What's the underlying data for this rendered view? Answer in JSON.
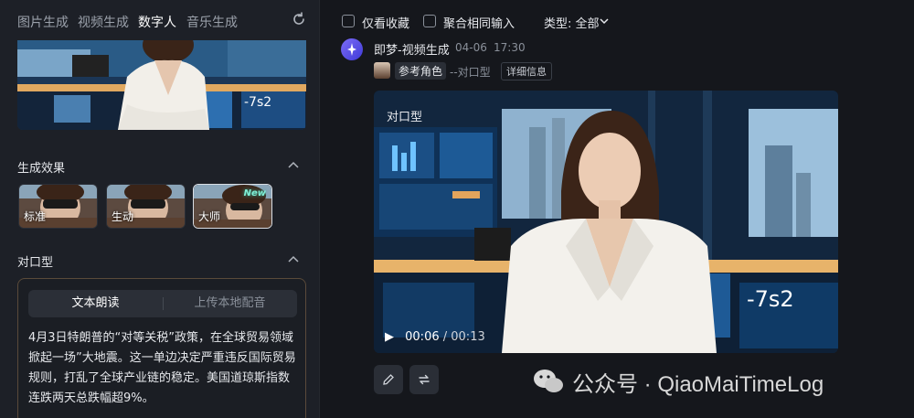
{
  "tabs": [
    "图片生成",
    "视频生成",
    "数字人",
    "音乐生成"
  ],
  "active_tab": 2,
  "sections": {
    "effect_title": "生成效果",
    "lipsync_title": "对口型"
  },
  "effects": [
    {
      "label": "标准",
      "selected": false
    },
    {
      "label": "生动",
      "selected": false
    },
    {
      "label": "大师",
      "selected": true,
      "badge": "New"
    }
  ],
  "lipsync": {
    "tabs": [
      "文本朗读",
      "上传本地配音"
    ],
    "active": 0,
    "text": "4月3日特朗普的“对等关税”政策，在全球贸易领域掀起一场”大地震。这一单边决定严重违反国际贸易规则，打乱了全球产业链的稳定。美国道琼斯指数连跌两天总跌幅超9%。"
  },
  "filters": {
    "favorites_only": "仅看收藏",
    "merge_same_input": "聚合相同输入",
    "type_label": "类型: 全部"
  },
  "generation": {
    "title": "即梦-视频生成",
    "date": "04-06",
    "time": "17:30",
    "ref_label": "参考角色",
    "ref_type": "--对口型",
    "detail_button": "详细信息",
    "video_tag": "对口型",
    "current_time": "00:06",
    "duration": "00:13"
  },
  "watermark": "公众号 · QiaoMaiTimeLog",
  "colors": {
    "background": "#15171c",
    "panel": "#1d2027",
    "accent": "#5b54e8"
  }
}
